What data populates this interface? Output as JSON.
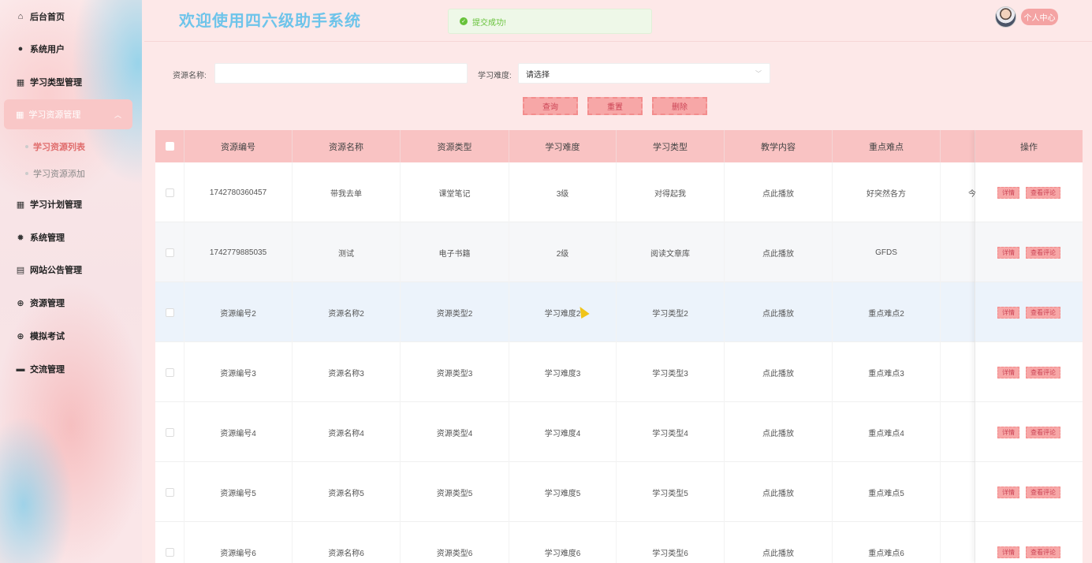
{
  "sidebar": {
    "items": [
      {
        "label": "后台首页",
        "icon": "home-icon"
      },
      {
        "label": "系统用户",
        "icon": "user-icon"
      },
      {
        "label": "学习类型管理",
        "icon": "grid-icon"
      },
      {
        "label": "学习资源管理",
        "icon": "grid-icon"
      },
      {
        "label": "学习计划管理",
        "icon": "grid-icon"
      },
      {
        "label": "系统管理",
        "icon": "gear-icon"
      },
      {
        "label": "网站公告管理",
        "icon": "doc-icon"
      },
      {
        "label": "资源管理",
        "icon": "plus-circle-icon"
      },
      {
        "label": "模拟考试",
        "icon": "plus-circle-icon"
      },
      {
        "label": "交流管理",
        "icon": "chat-icon"
      }
    ],
    "sub_items": [
      {
        "label": "学习资源列表"
      },
      {
        "label": "学习资源添加"
      }
    ]
  },
  "header": {
    "title": "欢迎使用四六级助手系统",
    "toast": "提交成功!",
    "profile_label": "个人中心"
  },
  "search": {
    "name_label": "资源名称:",
    "name_value": "",
    "difficulty_label": "学习难度:",
    "difficulty_value": "请选择",
    "query_button": "查询",
    "reset_button": "重置",
    "delete_button": "删除"
  },
  "table": {
    "columns": [
      "资源编号",
      "资源名称",
      "资源类型",
      "学习难度",
      "学习类型",
      "教学内容",
      "重点难点",
      "操作"
    ],
    "detail_label": "详情",
    "comments_label": "查看评论",
    "rows": [
      {
        "id": "1742780360457",
        "name": "带我去单",
        "type": "课堂笔记",
        "difficulty": "3级",
        "study_type": "对得起我",
        "content": "点此播放",
        "key_points": "好突然各方",
        "extra": "今"
      },
      {
        "id": "1742779885035",
        "name": "测试",
        "type": "电子书籍",
        "difficulty": "2级",
        "study_type": "阅读文章库",
        "content": "点此播放",
        "key_points": "GFDS",
        "extra": ""
      },
      {
        "id": "资源编号2",
        "name": "资源名称2",
        "type": "资源类型2",
        "difficulty": "学习难度2",
        "study_type": "学习类型2",
        "content": "点此播放",
        "key_points": "重点难点2",
        "extra": ""
      },
      {
        "id": "资源编号3",
        "name": "资源名称3",
        "type": "资源类型3",
        "difficulty": "学习难度3",
        "study_type": "学习类型3",
        "content": "点此播放",
        "key_points": "重点难点3",
        "extra": ""
      },
      {
        "id": "资源编号4",
        "name": "资源名称4",
        "type": "资源类型4",
        "difficulty": "学习难度4",
        "study_type": "学习类型4",
        "content": "点此播放",
        "key_points": "重点难点4",
        "extra": ""
      },
      {
        "id": "资源编号5",
        "name": "资源名称5",
        "type": "资源类型5",
        "difficulty": "学习难度5",
        "study_type": "学习类型5",
        "content": "点此播放",
        "key_points": "重点难点5",
        "extra": ""
      },
      {
        "id": "资源编号6",
        "name": "资源名称6",
        "type": "资源类型6",
        "difficulty": "学习难度6",
        "study_type": "学习类型6",
        "content": "点此播放",
        "key_points": "重点难点6",
        "extra": ""
      }
    ]
  }
}
